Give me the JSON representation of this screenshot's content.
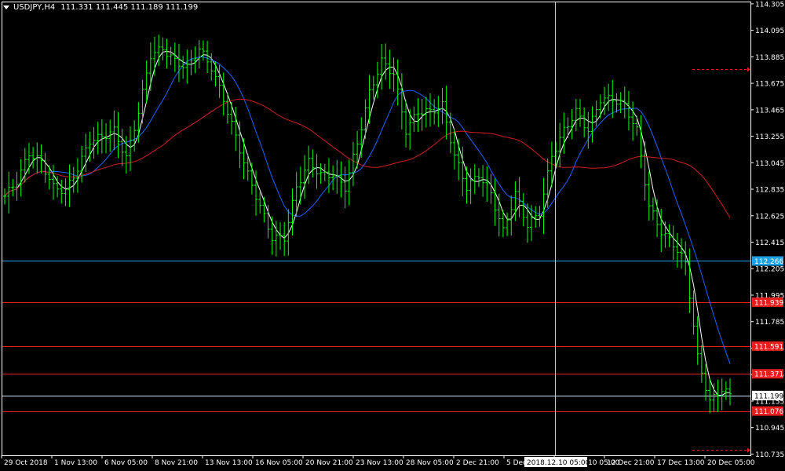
{
  "header": {
    "symbol": "USDJPY,H4",
    "ohlc": "111.331 111.445 111.189 111.199"
  },
  "colors": {
    "background": "#000000",
    "grid": "#ffffff",
    "candle": "#00ff00",
    "ma_fast": "#ffffff",
    "ma_mid": "#1e64ff",
    "ma_slow": "#d21e1e",
    "hline_blue": "#1ea0e6",
    "hline_red": "#e61e1e",
    "hline_white": "#c8e6ff",
    "crosshair": "#c8c8c8"
  },
  "chart_data": {
    "type": "candlestick",
    "ylim": [
      110.725,
      114.323
    ],
    "y_ticks": [
      "114.305",
      "114.095",
      "113.885",
      "113.675",
      "113.465",
      "113.255",
      "113.045",
      "112.835",
      "112.625",
      "112.415",
      "112.205",
      "111.995",
      "111.785",
      "111.575",
      "111.365",
      "111.155",
      "110.945",
      "110.735"
    ],
    "x_ticks": [
      "29 Oct 2018",
      "1 Nov 13:00",
      "6 Nov 05:00",
      "8 Nov 21:00",
      "13 Nov 13:00",
      "16 Nov 05:00",
      "20 Nov 21:00",
      "23 Nov 13:00",
      "28 Nov 05:00",
      "2 Dec 21:00",
      "5 Dec",
      "2018.12.10 05:00",
      "12 Dec 21:00",
      "17 Dec 13:00",
      "20 Dec 05:00"
    ],
    "crosshair_label": "2018.12.10 05:00",
    "price_keypoints": [
      [
        0,
        112.78
      ],
      [
        3,
        112.9
      ],
      [
        6,
        113.12
      ],
      [
        9,
        113.05
      ],
      [
        12,
        112.85
      ],
      [
        15,
        112.82
      ],
      [
        18,
        113.0
      ],
      [
        21,
        113.22
      ],
      [
        24,
        113.25
      ],
      [
        27,
        113.3
      ],
      [
        30,
        113.08
      ],
      [
        33,
        113.45
      ],
      [
        36,
        113.9
      ],
      [
        39,
        113.95
      ],
      [
        42,
        113.85
      ],
      [
        45,
        113.8
      ],
      [
        48,
        113.95
      ],
      [
        51,
        113.8
      ],
      [
        54,
        113.55
      ],
      [
        57,
        113.25
      ],
      [
        60,
        112.95
      ],
      [
        63,
        112.7
      ],
      [
        66,
        112.45
      ],
      [
        69,
        112.45
      ],
      [
        72,
        112.85
      ],
      [
        75,
        113.05
      ],
      [
        78,
        112.95
      ],
      [
        81,
        112.95
      ],
      [
        84,
        112.85
      ],
      [
        87,
        113.2
      ],
      [
        90,
        113.6
      ],
      [
        93,
        113.85
      ],
      [
        96,
        113.75
      ],
      [
        99,
        113.3
      ],
      [
        102,
        113.45
      ],
      [
        105,
        113.45
      ],
      [
        108,
        113.5
      ],
      [
        111,
        113.1
      ],
      [
        114,
        112.85
      ],
      [
        117,
        112.95
      ],
      [
        120,
        112.8
      ],
      [
        123,
        112.5
      ],
      [
        126,
        112.8
      ],
      [
        129,
        112.55
      ],
      [
        132,
        112.65
      ],
      [
        135,
        113.1
      ],
      [
        138,
        113.3
      ],
      [
        141,
        113.45
      ],
      [
        144,
        113.3
      ],
      [
        147,
        113.55
      ],
      [
        150,
        113.55
      ],
      [
        153,
        113.5
      ],
      [
        156,
        113.3
      ],
      [
        159,
        112.7
      ],
      [
        162,
        112.5
      ],
      [
        165,
        112.4
      ],
      [
        168,
        112.25
      ],
      [
        171,
        111.5
      ],
      [
        174,
        111.15
      ],
      [
        177,
        111.25
      ],
      [
        179,
        111.2
      ]
    ],
    "hlines": [
      {
        "value": 112.266,
        "label": "112.266",
        "style": "blue"
      },
      {
        "value": 111.939,
        "label": "111.939",
        "style": "red"
      },
      {
        "value": 111.591,
        "label": "111.591",
        "style": "red"
      },
      {
        "value": 111.371,
        "label": "111.371",
        "style": "red"
      },
      {
        "value": 111.199,
        "label": "111.199",
        "style": "white"
      },
      {
        "value": 111.076,
        "label": "111.076",
        "style": "red"
      }
    ],
    "stop_markers": [
      113.79,
      110.77
    ]
  }
}
